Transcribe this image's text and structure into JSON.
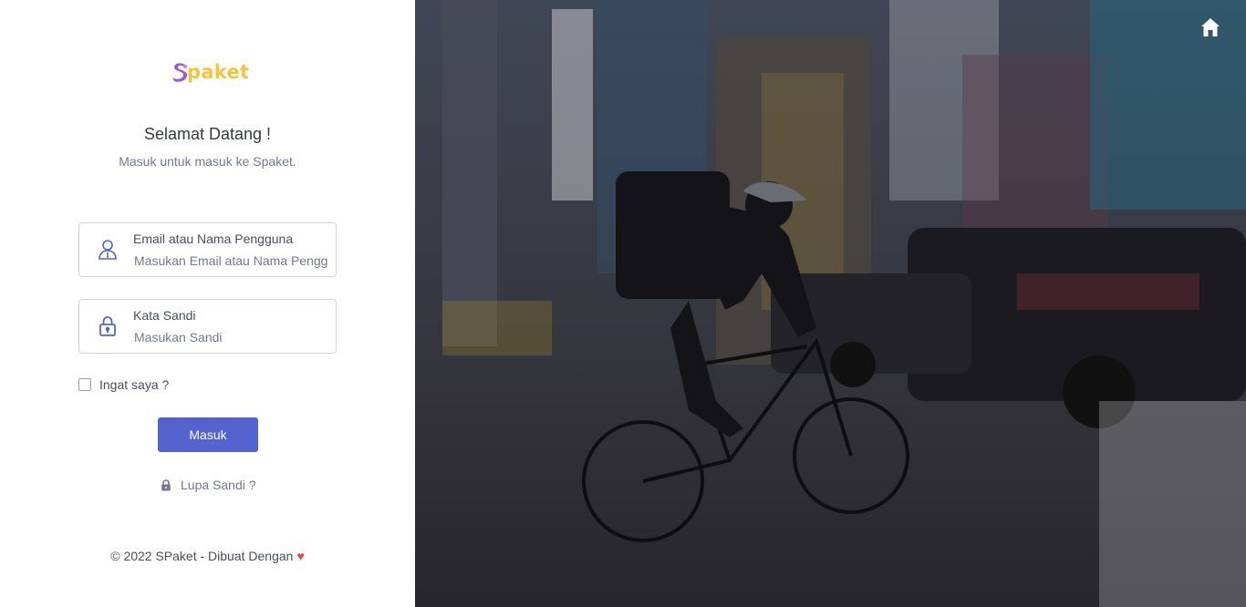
{
  "brand": {
    "name": "paket",
    "logo_colors": {
      "mark_purple": "#9b59d0",
      "mark_accent": "#c780ff",
      "text": "#f5c43d"
    }
  },
  "header": {
    "title": "Selamat Datang !",
    "subtitle": "Masuk untuk masuk ke Spaket."
  },
  "form": {
    "username": {
      "label": "Email atau Nama Pengguna",
      "placeholder": "Masukan Email atau Nama Pengguna",
      "value": "",
      "icon": "user-icon"
    },
    "password": {
      "label": "Kata Sandi",
      "placeholder": "Masukan Sandi",
      "value": "",
      "icon": "lock-icon"
    },
    "remember_label": "Ingat saya ?",
    "remember_checked": false,
    "submit_label": "Masuk",
    "forgot_label": "Lupa Sandi ?"
  },
  "footer": {
    "text": "© 2022 SPaket - Dibuat Dengan",
    "heart": "♥"
  },
  "hero": {
    "description_icon": "home-icon"
  },
  "colors": {
    "primary": "#5663cf",
    "icon": "#5663cf",
    "heart": "#f1454e"
  }
}
